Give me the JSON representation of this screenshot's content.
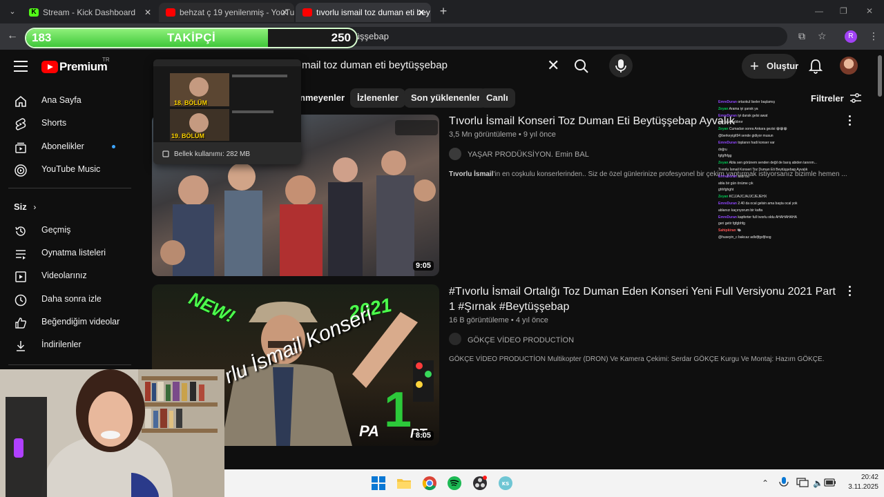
{
  "browser": {
    "tabs": [
      {
        "title": "Stream - Kick Dashboard",
        "favicon": "kick-icon",
        "active": false
      },
      {
        "title": "behzat ç 19 yenilenmiş - YouTube",
        "favicon": "youtube-icon",
        "active": false
      },
      {
        "title": "tıvorlu ismail toz duman eti bey",
        "favicon": "youtube-icon",
        "active": true
      }
    ],
    "address_text": "man+eti+beytüşşebap",
    "profile_initial": "R"
  },
  "follower_goal": {
    "current": "183",
    "label": "TAKİPÇİ",
    "goal": "250",
    "progress": 0.732
  },
  "youtube": {
    "logo_text": "Premium",
    "region": "TR",
    "search_query": "mail toz duman eti beytüşşebap",
    "create_label": "Oluştur",
    "filters_label": "Filtreler",
    "chips": [
      "nmeyenler",
      "İzlenenler",
      "Son yüklenenler",
      "Canlı"
    ],
    "sidebar": {
      "main": [
        {
          "label": "Ana Sayfa",
          "icon": "home-icon"
        },
        {
          "label": "Shorts",
          "icon": "shorts-icon"
        },
        {
          "label": "Abonelikler",
          "icon": "subscriptions-icon"
        },
        {
          "label": "YouTube Music",
          "icon": "youtube-music-icon"
        }
      ],
      "you_label": "Siz",
      "you": [
        {
          "label": "Geçmiş",
          "icon": "history-icon"
        },
        {
          "label": "Oynatma listeleri",
          "icon": "playlists-icon"
        },
        {
          "label": "Videolarınız",
          "icon": "your-videos-icon"
        },
        {
          "label": "Daha sonra izle",
          "icon": "watch-later-icon"
        },
        {
          "label": "Beğendiğim videolar",
          "icon": "liked-videos-icon"
        },
        {
          "label": "İndirilenler",
          "icon": "downloads-icon"
        }
      ]
    },
    "videos": [
      {
        "title": "Tıvorlu İsmail Konseri Toz Duman Eti Beytüşşebap Ayvalık",
        "views": "3,5 Mn görüntüleme",
        "age": "9 yıl önce",
        "channel": "YAŞAR PRODÜKSİYON. Emin BAL",
        "description_bold": "Tıvorlu İsmail",
        "description": "'in en coşkulu konserlerinden.. Siz de özel günlerinize profesyonel bir çekim yaptırmak istiyorsanız bizimle hemen ...",
        "duration": "9:05"
      },
      {
        "title": "#Tıvorlu İsmail Ortalığı Toz Duman Eden Konseri Yeni Full Versiyonu 2021 Part 1 #Şırnak #Beytüşşebap",
        "views": "16 B görüntüleme",
        "age": "4 yıl önce",
        "channel": "GÖKÇE VİDEO PRODUCTİON",
        "description": "GÖKÇE VİDEO PRODUCTİON Multikopter (DRON) Ve Kamera Çekimi: Serdar GÖKÇE Kurgu Ve Montaj: Hazım GÖKÇE.",
        "duration": "8:05",
        "thumb_text": [
          "NEW!",
          "2021",
          "rlu İsmail Konseri",
          "PA",
          "1",
          "RT"
        ]
      }
    ]
  },
  "tab_preview": {
    "memory": "Bellek kullanımı: 282 MB",
    "labels": [
      "18. BÖLÜM",
      "19. BÖLÜM"
    ]
  },
  "chat": [
    {
      "user": "EmreDuran",
      "color": "#9147ff",
      "text": "ortaokul liseler başlamış"
    },
    {
      "user": "Zeyan",
      "color": "#00c853",
      "text": "Arama iyi şansk ya"
    },
    {
      "user": "EmreDuran",
      "color": "#9147ff",
      "text": "iyi dansk gelsi awat"
    },
    {
      "user": "",
      "color": "#e040fb",
      "text": "gaz gaz haldınır"
    },
    {
      "user": "Zeyan",
      "color": "#00c853",
      "text": "Cumadan sonra Ankara gezisi 😀😀😀"
    },
    {
      "user": "",
      "color": "#e040fb",
      "text": "@berkeyigit94 sende gidiyor musun"
    },
    {
      "user": "EmreDuran",
      "color": "#9147ff",
      "text": "toplanın hadi konser var"
    },
    {
      "user": "",
      "color": "#e040fb",
      "text": "doğru"
    },
    {
      "user": "",
      "color": "#e040fb",
      "text": "fgfgfhfgg"
    },
    {
      "user": "Zeyan",
      "color": "#00c853",
      "text": "Abla sen görünem senden değil de barış abiden tanırım..."
    },
    {
      "user": "",
      "color": "#e040fb",
      "text": "Tıvorlu İsmail Konseri Toz Duman Eti Beytüşşebap Ayvalık"
    },
    {
      "user": "EmreDuran",
      "color": "#9147ff",
      "text": "asdı bu"
    },
    {
      "user": "",
      "color": "#e040fb",
      "text": "abla bir gün önüme çık"
    },
    {
      "user": "",
      "color": "#e040fb",
      "text": "ghhfghght"
    },
    {
      "user": "Zeyan",
      "color": "#00c853",
      "text": "KCJJAJCJAJJCJEJEHX"
    },
    {
      "user": "EmreDuran",
      "color": "#9147ff",
      "text": "2.40 da ocal gelsin ama başta ocal yok"
    },
    {
      "user": "",
      "color": "#e040fb",
      "text": "ablanızı kaçırıyorum bir kafta"
    },
    {
      "user": "EmreDuran",
      "color": "#9147ff",
      "text": "kapferter full tıvorlu oldu AHAHAHAHA"
    },
    {
      "user": "",
      "color": "#e040fb",
      "text": "geri getir fgfgbhfg"
    },
    {
      "user": "Sahipkiran",
      "color": "#ff5252",
      "text": "🐃"
    },
    {
      "user": "",
      "color": "#e040fb",
      "text": "@huseyin_c bakcaz adlsfjfgsfjfsog"
    }
  ],
  "taskbar": {
    "time": "20:42",
    "date": "3.11.2025"
  },
  "colors": {
    "youtube_red": "#ff0000",
    "follow_green": "#4cd340",
    "bg": "#0f0f0f"
  }
}
